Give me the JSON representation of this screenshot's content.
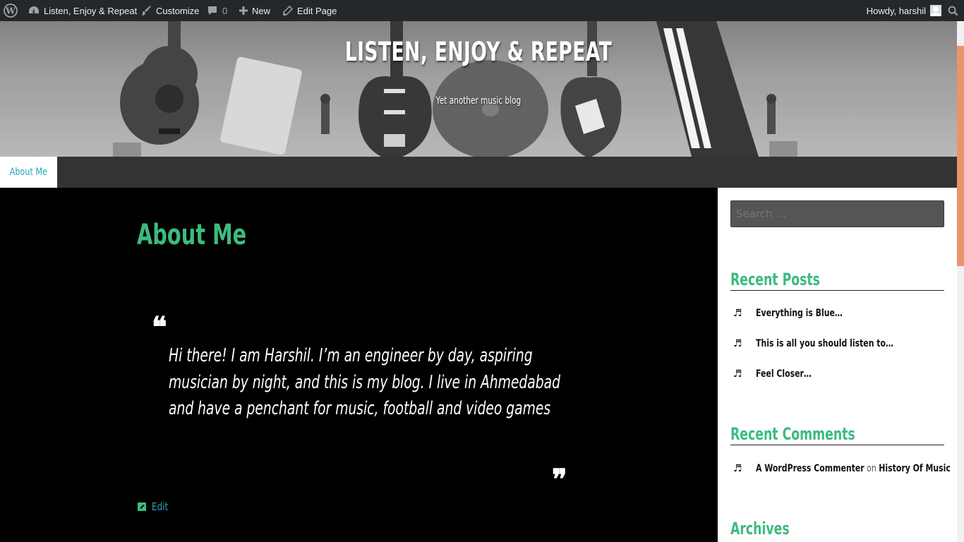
{
  "admin_bar": {
    "site_name": "Listen, Enjoy & Repeat",
    "customize": "Customize",
    "comments_count": "0",
    "new_label": "New",
    "edit_page": "Edit Page",
    "howdy": "Howdy, harshil"
  },
  "header": {
    "title": "LISTEN, ENJOY & REPEAT",
    "description": "Yet another music blog"
  },
  "nav": {
    "items": [
      {
        "label": "About Me"
      }
    ]
  },
  "page": {
    "title": "About Me",
    "quote_open": "❝",
    "quote_close": "❞",
    "quote": "Hi there! I am Harshil. I’m an engineer by day, aspiring musician by night, and this is my blog. I live in Ahmedabad and have a penchant for music, football and video games",
    "edit_label": "Edit"
  },
  "sidebar": {
    "search_placeholder": "Search …",
    "recent_posts_title": "Recent Posts",
    "recent_posts": [
      {
        "title": "Everything is Blue…"
      },
      {
        "title": "This is all you should listen to…"
      },
      {
        "title": "Feel Closer…"
      }
    ],
    "recent_comments_title": "Recent Comments",
    "recent_comments": [
      {
        "author": "A WordPress Commenter",
        "on": "on",
        "post": "History Of Music"
      }
    ],
    "archives_title": "Archives"
  },
  "icons": {
    "wordpress": "wordpress-icon",
    "dashboard": "dashboard-icon",
    "brush": "customize-brush-icon",
    "comment": "comment-bubble-icon",
    "plus": "plus-icon",
    "pencil": "pencil-icon",
    "search": "search-icon",
    "note": "music-note-icon"
  },
  "colors": {
    "accent_green": "#3dbb7f",
    "link_teal": "#2aa6b6",
    "admin_bar": "#23282d",
    "scroll_thumb": "#e8956b"
  }
}
